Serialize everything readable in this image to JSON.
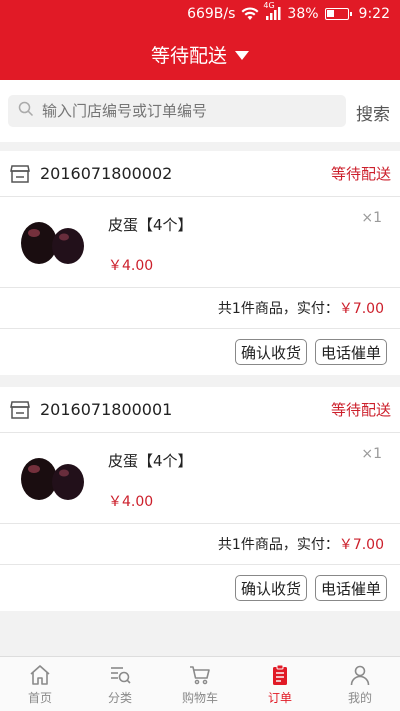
{
  "status_bar": {
    "net_speed": "669B/s",
    "network": "4G",
    "battery": "38%",
    "battery_level": 0.38,
    "time": "9:22"
  },
  "header": {
    "title": "等待配送"
  },
  "search": {
    "placeholder": "输入门店编号或订单编号",
    "button": "搜索"
  },
  "orders": [
    {
      "order_no": "2016071800002",
      "status": "等待配送",
      "item": {
        "name": "皮蛋【4个】",
        "price": "￥4.00",
        "qty": "×1"
      },
      "summary_prefix": "共1件商品，实付：",
      "total": "￥7.00",
      "actions": [
        "确认收货",
        "电话催单"
      ]
    },
    {
      "order_no": "2016071800001",
      "status": "等待配送",
      "item": {
        "name": "皮蛋【4个】",
        "price": "￥4.00",
        "qty": "×1"
      },
      "summary_prefix": "共1件商品，实付：",
      "total": "￥7.00",
      "actions": [
        "确认收货",
        "电话催单"
      ]
    }
  ],
  "tabbar": {
    "items": [
      {
        "label": "首页",
        "icon": "home-icon"
      },
      {
        "label": "分类",
        "icon": "category-icon"
      },
      {
        "label": "购物车",
        "icon": "cart-icon"
      },
      {
        "label": "订单",
        "icon": "order-icon"
      },
      {
        "label": "我的",
        "icon": "user-icon"
      }
    ],
    "active_index": 3
  },
  "colors": {
    "brand": "#e11a26",
    "price": "#cc1f2b",
    "background": "#f2f2f2"
  }
}
